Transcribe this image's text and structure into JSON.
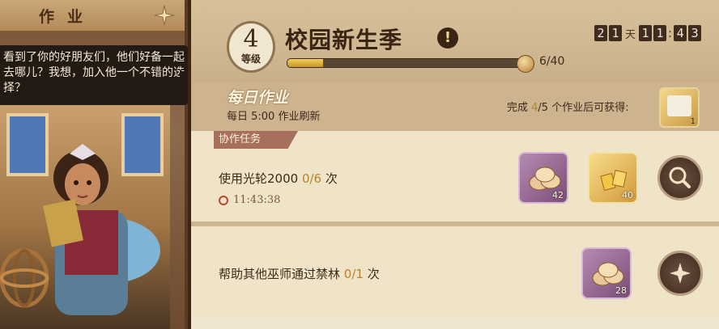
{
  "left_panel": {
    "title": "作业",
    "speech": "看到了你的好朋友们，他们好备一起去哪儿？我想，加入他一个不错的选择？"
  },
  "season": {
    "level_number": "4",
    "level_label": "等级",
    "title": "校园新生季",
    "info_symbol": "!",
    "timer": {
      "days_digits": [
        "2",
        "1"
      ],
      "day_label": "天",
      "hour_digits": [
        "1",
        "1"
      ],
      "min_digits": [
        "4",
        "3"
      ]
    },
    "progress_text": "6/40",
    "progress_fraction": 0.15
  },
  "daily": {
    "title": "每日作业",
    "subtitle": "每日 5:00 作业刷新",
    "reward_prefix": "完成 ",
    "reward_done": "4",
    "reward_suffix": "/5 个作业后可获得:",
    "reward_count": "1"
  },
  "coop_tab": "协作任务",
  "tasks": [
    {
      "name": "使用光轮2000 ",
      "progress": "0/6",
      "unit": " 次",
      "time": "11:43:38",
      "rewards": [
        {
          "type": "coins",
          "count": "42"
        },
        {
          "type": "gold",
          "count": "40"
        }
      ]
    },
    {
      "name": "帮助其他巫师通过禁林 ",
      "progress": "0/1",
      "unit": " 次",
      "rewards": [
        {
          "type": "coins",
          "count": "28"
        }
      ]
    }
  ],
  "colors": {
    "accent_gold": "#b8842c",
    "dark_brown": "#3a2414",
    "parchment": "#efe3c8"
  }
}
